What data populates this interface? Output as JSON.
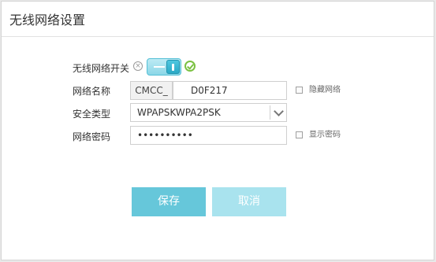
{
  "page": {
    "title": "无线网络设置"
  },
  "form": {
    "wireless_switch_label": "无线网络开关",
    "ssid_label": "网络名称",
    "ssid_prefix": "CMCC_",
    "ssid_value": "D0F217",
    "hide_network_label": "隐藏网络",
    "security_label": "安全类型",
    "security_value": "WPAPSKWPA2PSK",
    "password_label": "网络密码",
    "password_value": "••••••••••",
    "show_password_label": "显示密码",
    "wireless_enabled": true,
    "hide_network_checked": false,
    "show_password_checked": false
  },
  "buttons": {
    "save": "保存",
    "cancel": "取消"
  },
  "icons": {
    "toggle_off": "x-circle-icon",
    "toggle_on": "check-circle-icon",
    "dropdown": "chevron-down-icon"
  },
  "colors": {
    "accent": "#66c7da",
    "accent_light": "#a9e3ee",
    "switch": "#4fc6df",
    "success": "#7bc142"
  }
}
